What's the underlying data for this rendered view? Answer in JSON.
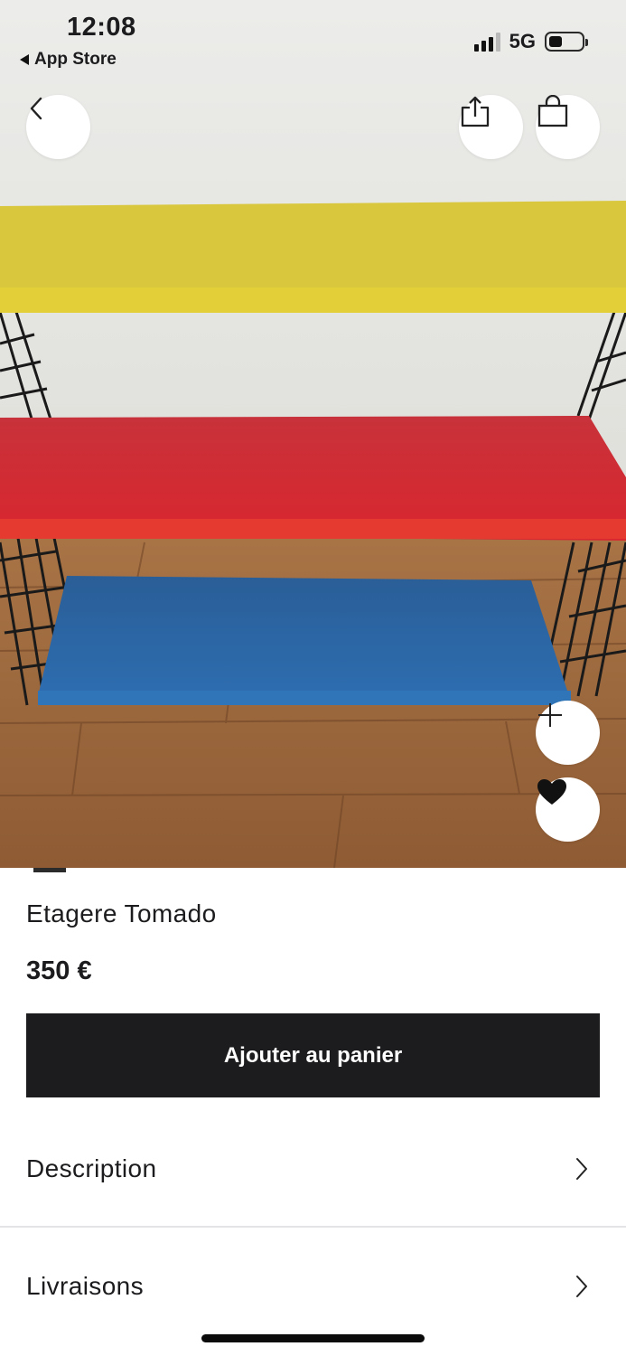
{
  "status_bar": {
    "time": "12:08",
    "back_app": "App Store",
    "network": "5G"
  },
  "hero": {
    "icons": {
      "back": "chevron-left-icon",
      "share": "share-icon",
      "bag": "shopping-bag-icon",
      "add": "plus-icon",
      "favorite": "heart-icon"
    }
  },
  "product": {
    "title": "Etagere Tomado",
    "price": "350 €",
    "add_to_cart_label": "Ajouter au panier"
  },
  "sections": [
    {
      "label": "Description"
    },
    {
      "label": "Livraisons"
    }
  ],
  "colors": {
    "cta_background": "#1c1c1e",
    "shelf_yellow": "#d8c53a",
    "shelf_red": "#d42a33",
    "shelf_blue": "#2a67a6"
  }
}
